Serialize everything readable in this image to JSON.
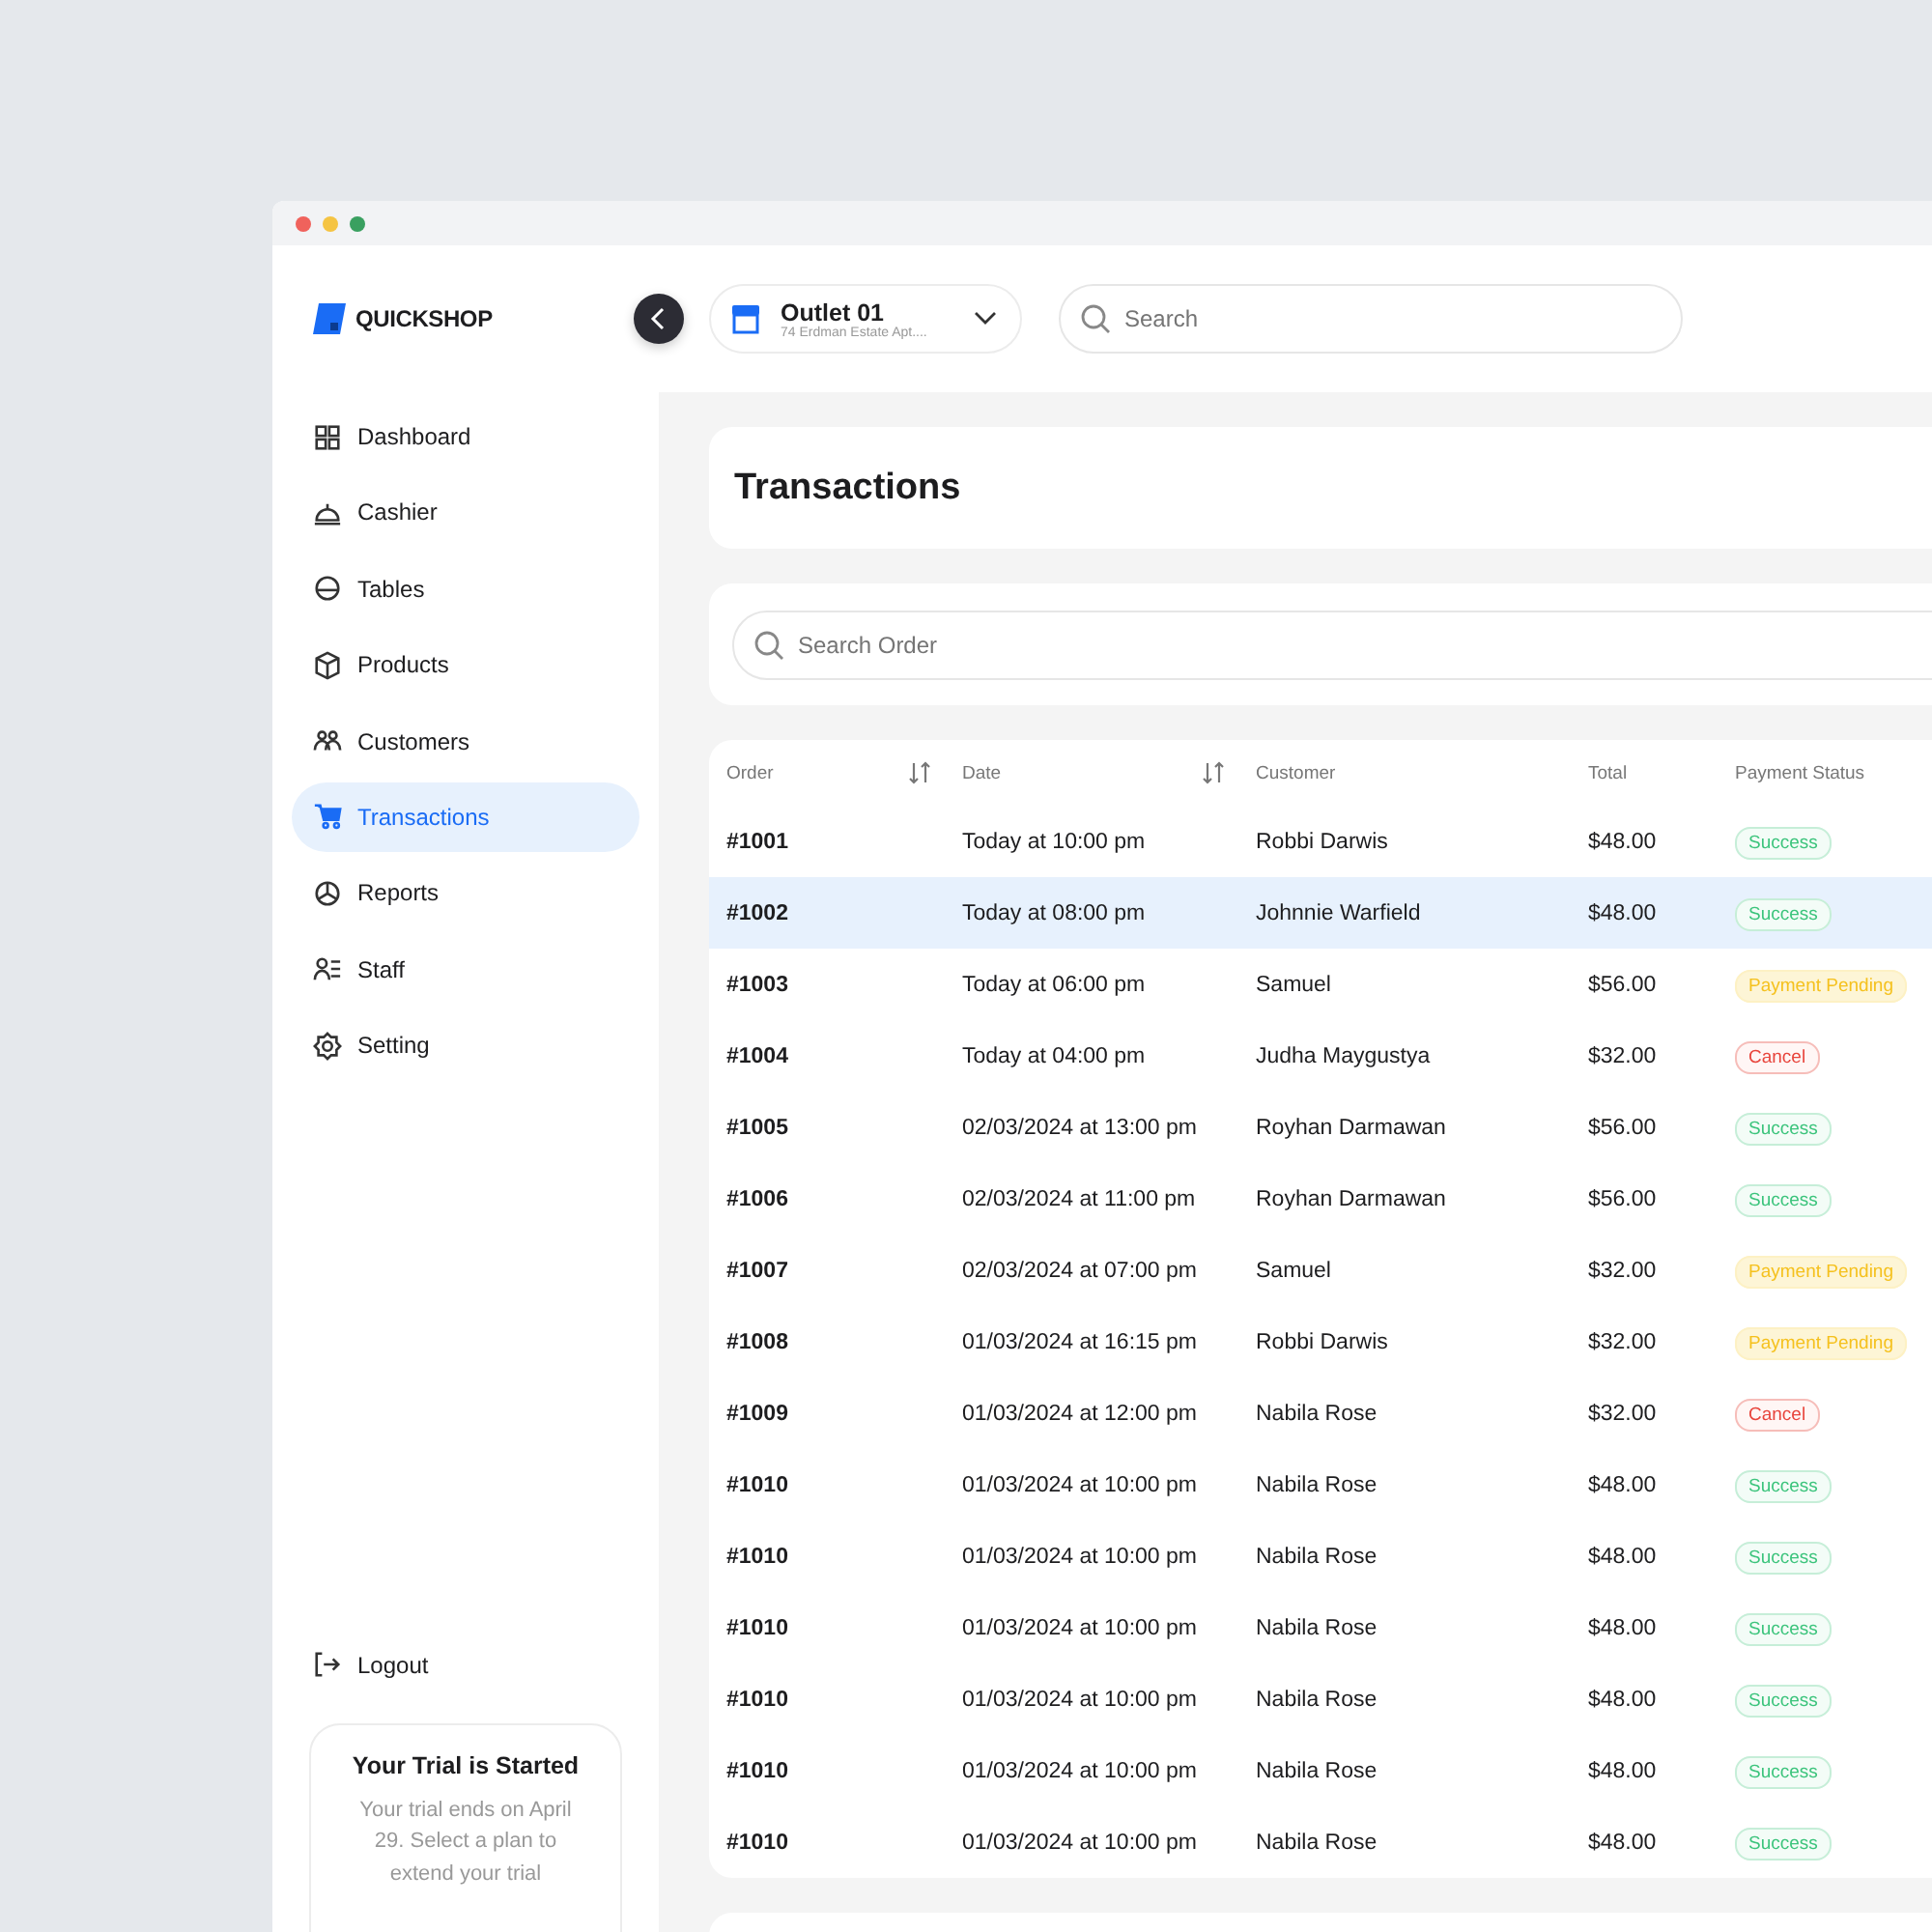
{
  "brand": "QUICKSHOP",
  "outlet": {
    "name": "Outlet 01",
    "address": "74 Erdman Estate Apt...."
  },
  "search": {
    "placeholder": "Search"
  },
  "sidebar": {
    "items": [
      {
        "label": "Dashboard",
        "selected": false
      },
      {
        "label": "Cashier",
        "selected": false
      },
      {
        "label": "Tables",
        "selected": false
      },
      {
        "label": "Products",
        "selected": false
      },
      {
        "label": "Customers",
        "selected": false
      },
      {
        "label": "Transactions",
        "selected": true
      },
      {
        "label": "Reports",
        "selected": false
      },
      {
        "label": "Staff",
        "selected": false
      },
      {
        "label": "Setting",
        "selected": false
      }
    ],
    "logout": "Logout",
    "trial": {
      "title": "Your Trial is Started",
      "text": "Your trial ends on April 29. Select a plan to extend your trial"
    }
  },
  "page_title": "Transactions",
  "order_search": {
    "placeholder": "Search Order"
  },
  "table": {
    "columns": [
      {
        "label": "Order",
        "sortable": true
      },
      {
        "label": "Date",
        "sortable": true
      },
      {
        "label": "Customer",
        "sortable": false
      },
      {
        "label": "Total",
        "sortable": false
      },
      {
        "label": "Payment Status",
        "sortable": false
      }
    ],
    "rows": [
      {
        "order": "#1001",
        "date": "Today at 10:00 pm",
        "customer": "Robbi Darwis",
        "total": "$48.00",
        "status": "Success",
        "kind": "success",
        "selected": false
      },
      {
        "order": "#1002",
        "date": "Today at 08:00 pm",
        "customer": "Johnnie Warfield",
        "total": "$48.00",
        "status": "Success",
        "kind": "success",
        "selected": true
      },
      {
        "order": "#1003",
        "date": "Today at 06:00 pm",
        "customer": "Samuel",
        "total": "$56.00",
        "status": "Payment Pending",
        "kind": "pending",
        "selected": false
      },
      {
        "order": "#1004",
        "date": "Today at 04:00 pm",
        "customer": "Judha Maygustya",
        "total": "$32.00",
        "status": "Cancel",
        "kind": "cancel",
        "selected": false
      },
      {
        "order": "#1005",
        "date": "02/03/2024 at 13:00 pm",
        "customer": "Royhan Darmawan",
        "total": "$56.00",
        "status": "Success",
        "kind": "success",
        "selected": false
      },
      {
        "order": "#1006",
        "date": "02/03/2024 at 11:00 pm",
        "customer": "Royhan Darmawan",
        "total": "$56.00",
        "status": "Success",
        "kind": "success",
        "selected": false
      },
      {
        "order": "#1007",
        "date": "02/03/2024 at 07:00 pm",
        "customer": "Samuel",
        "total": "$32.00",
        "status": "Payment Pending",
        "kind": "pending",
        "selected": false
      },
      {
        "order": "#1008",
        "date": "01/03/2024 at 16:15 pm",
        "customer": "Robbi Darwis",
        "total": "$32.00",
        "status": "Payment Pending",
        "kind": "pending",
        "selected": false
      },
      {
        "order": "#1009",
        "date": "01/03/2024 at 12:00 pm",
        "customer": "Nabila Rose",
        "total": "$32.00",
        "status": "Cancel",
        "kind": "cancel",
        "selected": false
      },
      {
        "order": "#1010",
        "date": "01/03/2024 at 10:00 pm",
        "customer": "Nabila Rose",
        "total": "$48.00",
        "status": "Success",
        "kind": "success",
        "selected": false
      },
      {
        "order": "#1010",
        "date": "01/03/2024 at 10:00 pm",
        "customer": "Nabila Rose",
        "total": "$48.00",
        "status": "Success",
        "kind": "success",
        "selected": false
      },
      {
        "order": "#1010",
        "date": "01/03/2024 at 10:00 pm",
        "customer": "Nabila Rose",
        "total": "$48.00",
        "status": "Success",
        "kind": "success",
        "selected": false
      },
      {
        "order": "#1010",
        "date": "01/03/2024 at 10:00 pm",
        "customer": "Nabila Rose",
        "total": "$48.00",
        "status": "Success",
        "kind": "success",
        "selected": false
      },
      {
        "order": "#1010",
        "date": "01/03/2024 at 10:00 pm",
        "customer": "Nabila Rose",
        "total": "$48.00",
        "status": "Success",
        "kind": "success",
        "selected": false
      },
      {
        "order": "#1010",
        "date": "01/03/2024 at 10:00 pm",
        "customer": "Nabila Rose",
        "total": "$48.00",
        "status": "Success",
        "kind": "success",
        "selected": false
      }
    ]
  }
}
